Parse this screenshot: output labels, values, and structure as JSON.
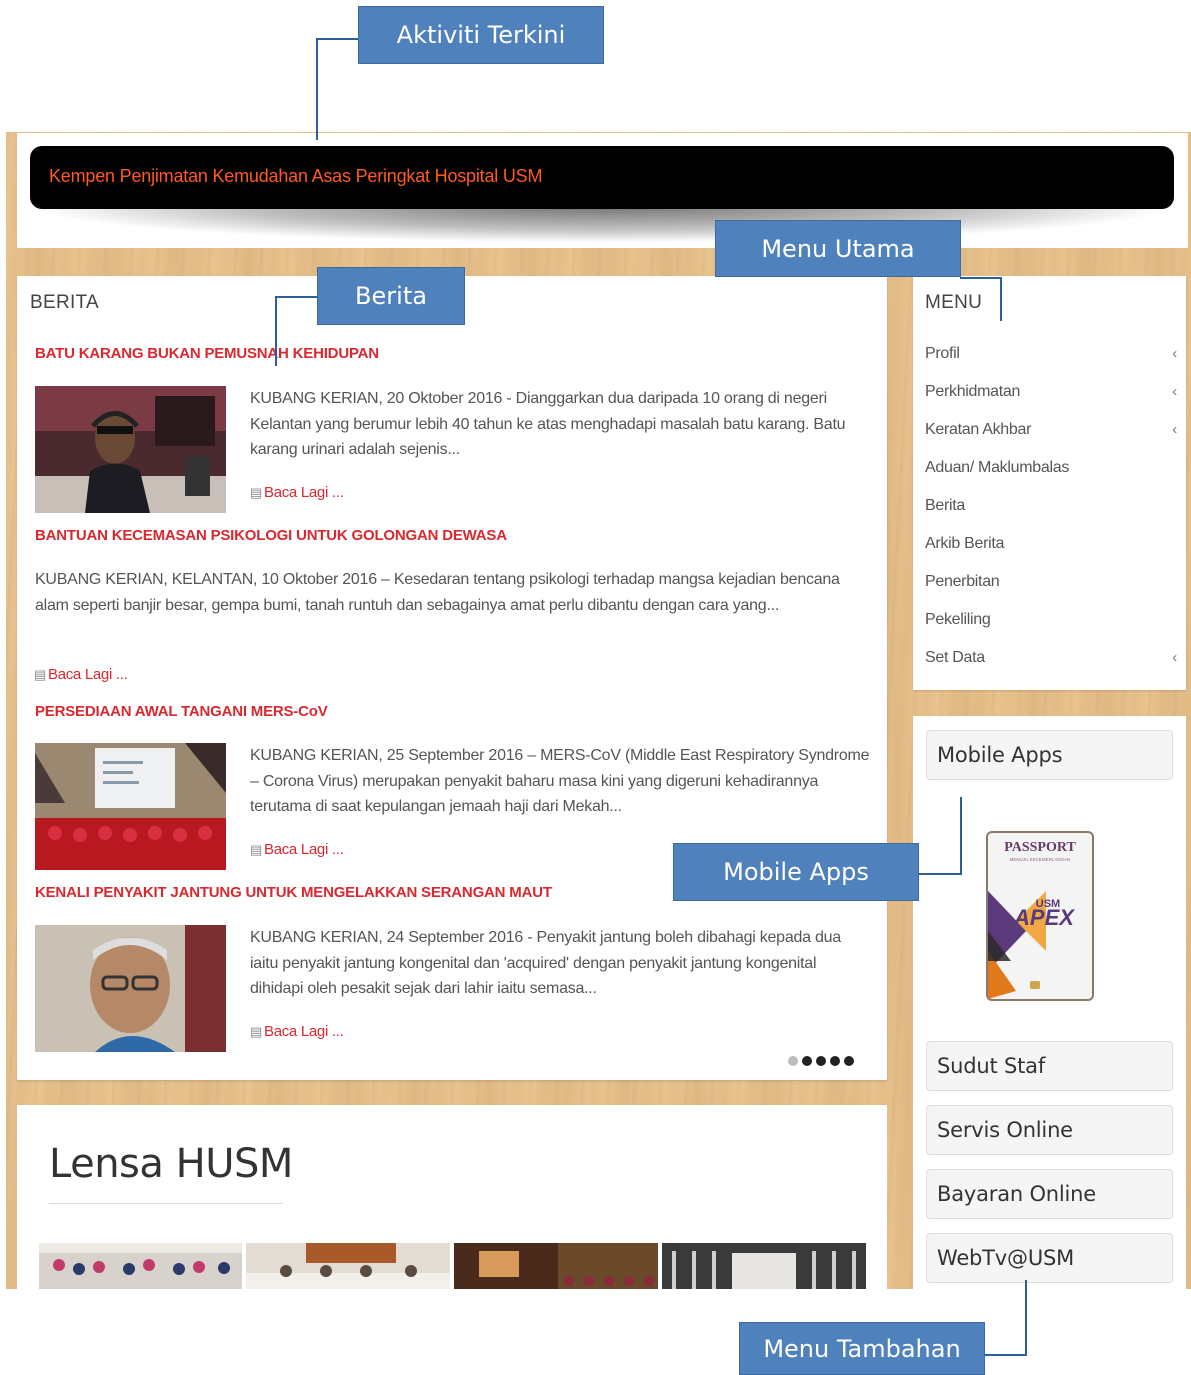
{
  "annotations": {
    "aktiviti_terkini": "Aktiviti Terkini",
    "menu_utama": "Menu Utama",
    "berita": "Berita",
    "mobile_apps": "Mobile Apps",
    "menu_tambahan": "Menu Tambahan"
  },
  "ticker": {
    "text": "Kempen Penjimatan Kemudahan Asas Peringkat Hospital USM"
  },
  "news": {
    "title": "BERITA",
    "items": [
      {
        "title": "BATU KARANG BUKAN PEMUSNAH KEHIDUPAN",
        "body": "KUBANG KERIAN, 20 Oktober 2016 - Dianggarkan dua daripada 10 orang di negeri Kelantan yang berumur lebih 40 tahun ke atas menghadapi masalah batu karang. Batu karang urinari adalah sejenis...",
        "read_more": "Baca Lagi ..."
      },
      {
        "title": "BANTUAN KECEMASAN PSIKOLOGI UNTUK GOLONGAN DEWASA",
        "body": "KUBANG KERIAN, KELANTAN, 10 Oktober 2016 – Kesedaran tentang psikologi terhadap mangsa kejadian bencana alam seperti banjir besar, gempa bumi, tanah runtuh dan sebagainya amat perlu dibantu dengan cara yang...",
        "read_more": "Baca Lagi ..."
      },
      {
        "title": "PERSEDIAAN AWAL TANGANI MERS-CoV",
        "body": "KUBANG KERIAN, 25 September 2016 – MERS-CoV (Middle East Respiratory Syndrome – Corona Virus) merupakan penyakit baharu masa kini yang digeruni kehadirannya terutama di saat kepulangan jemaah haji dari Mekah...",
        "read_more": "Baca Lagi ..."
      },
      {
        "title": "KENALI PENYAKIT JANTUNG UNTUK MENGELAKKAN SERANGAN MAUT",
        "body": "KUBANG KERIAN, 24 September 2016 - Penyakit  jantung boleh dibahagi kepada dua iaitu penyakit jantung kongenital dan 'acquired' dengan penyakit jantung kongenital dihidapi oleh pesakit sejak dari lahir iaitu semasa...",
        "read_more": "Baca Lagi ..."
      }
    ]
  },
  "lensa": {
    "title": "Lensa HUSM"
  },
  "menu": {
    "title": "MENU",
    "items": [
      {
        "label": "Profil",
        "has_submenu": true
      },
      {
        "label": "Perkhidmatan",
        "has_submenu": true
      },
      {
        "label": "Keratan Akhbar",
        "has_submenu": true
      },
      {
        "label": "Aduan/ Maklumbalas",
        "has_submenu": false
      },
      {
        "label": "Berita",
        "has_submenu": false
      },
      {
        "label": "Arkib Berita",
        "has_submenu": false
      },
      {
        "label": "Penerbitan",
        "has_submenu": false
      },
      {
        "label": "Pekeliling",
        "has_submenu": false
      },
      {
        "label": "Set Data",
        "has_submenu": true
      }
    ]
  },
  "side": {
    "mobile_apps": "Mobile Apps",
    "passport": {
      "title": "PASSPORT",
      "subtitle": "MENUJU KECEMERLANGAN",
      "logo": "USM",
      "brand": "APEX"
    },
    "buttons": [
      "Sudut Staf",
      "Servis Online",
      "Bayaran Online",
      "WebTv@USM"
    ]
  },
  "colors": {
    "accent_red": "#d9282f",
    "ticker_text": "#ff5a1f",
    "callout_blue": "#4f81bd",
    "wood": "#e9c48f"
  }
}
